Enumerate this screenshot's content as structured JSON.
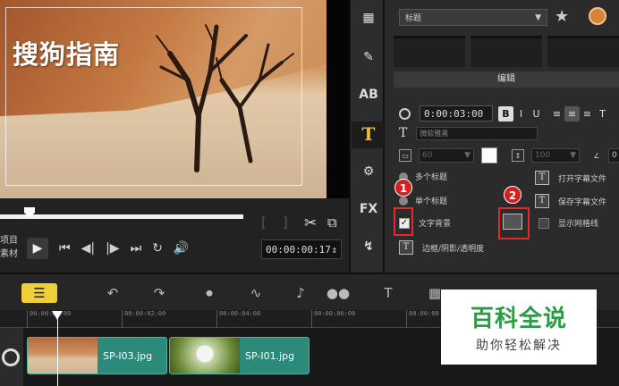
{
  "preview": {
    "overlay_title": "搜狗指南",
    "mode_labels": [
      "项目",
      "素材"
    ],
    "timecode": "00:00:00:17"
  },
  "panel": {
    "preset_label": "标题",
    "edit_tab": "编辑",
    "duration": "0:00:03:00",
    "font_name": "微软雅黑",
    "font_size": "60",
    "line_spacing": "100",
    "rotation": "0"
  },
  "options": {
    "multi_title": "多个标题",
    "single_title": "单个标题",
    "text_background": "文字背景",
    "border_shadow": "边框/阴影/透明度",
    "open_subtitle": "打开字幕文件",
    "save_subtitle": "保存字幕文件",
    "show_grid": "显示网格线"
  },
  "annotations": {
    "badge1": "1",
    "badge2": "2"
  },
  "timeline": {
    "ruler_ticks": [
      "00:00:00:00",
      "00:00:02:00",
      "00:00:04:00",
      "00:00:06:00",
      "00:00:08"
    ],
    "clips": [
      {
        "label": "SP-I03.jpg"
      },
      {
        "label": "SP-I01.jpg"
      }
    ]
  },
  "watermark": {
    "main": "百科全说",
    "sub": "助你轻松解决"
  },
  "colors": {
    "accent_yellow": "#f1cf39",
    "clip_teal": "#2b8a7a",
    "annotation_red": "#e12b2b",
    "watermark_green": "#2c9b45"
  }
}
